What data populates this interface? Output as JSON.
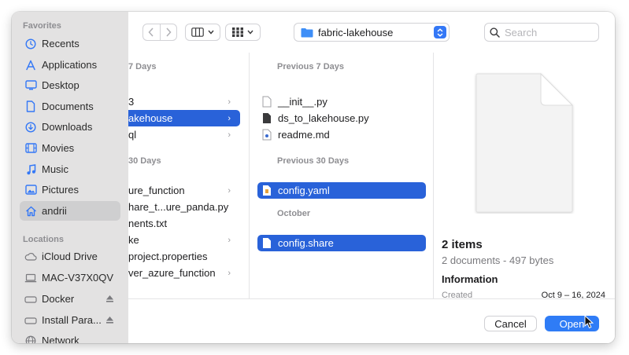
{
  "sidebar": {
    "favorites_heading": "Favorites",
    "favorites": [
      {
        "label": "Recents",
        "icon": "clock-icon"
      },
      {
        "label": "Applications",
        "icon": "applications-icon"
      },
      {
        "label": "Desktop",
        "icon": "desktop-icon"
      },
      {
        "label": "Documents",
        "icon": "document-icon"
      },
      {
        "label": "Downloads",
        "icon": "download-icon"
      },
      {
        "label": "Movies",
        "icon": "film-icon"
      },
      {
        "label": "Music",
        "icon": "music-icon"
      },
      {
        "label": "Pictures",
        "icon": "photo-icon"
      },
      {
        "label": "andrii",
        "icon": "home-icon",
        "selected": true
      }
    ],
    "locations_heading": "Locations",
    "locations": [
      {
        "label": "iCloud Drive",
        "icon": "cloud-icon"
      },
      {
        "label": "MAC-V37X0QV",
        "icon": "laptop-icon"
      },
      {
        "label": "Docker",
        "icon": "drive-icon",
        "eject": true
      },
      {
        "label": "Install Para...",
        "icon": "drive-icon",
        "eject": true
      },
      {
        "label": "Network",
        "icon": "globe-icon"
      }
    ]
  },
  "toolbar": {
    "location": "fabric-lakehouse",
    "search_placeholder": "Search"
  },
  "column1": {
    "headings": [
      "7 Days",
      "30 Days"
    ],
    "items": [
      {
        "label": "3"
      },
      {
        "label": "akehouse",
        "selected": true
      },
      {
        "label": "ql"
      },
      {
        "label": "ure_function"
      },
      {
        "label": "hare_t...ure_panda.py"
      },
      {
        "label": "nents.txt"
      },
      {
        "label": "ke"
      },
      {
        "label": "project.properties"
      },
      {
        "label": "ver_azure_function"
      }
    ]
  },
  "column2": {
    "headings": [
      "Previous 7 Days",
      "Previous 30 Days",
      "October"
    ],
    "items": [
      {
        "label": "__init__.py"
      },
      {
        "label": "ds_to_lakehouse.py"
      },
      {
        "label": "readme.md"
      },
      {
        "label": "config.yaml",
        "selected": true
      },
      {
        "label": "config.share",
        "selected": true
      }
    ]
  },
  "preview": {
    "title": "2 items",
    "subtitle": "2 documents - 497 bytes",
    "info_heading": "Information",
    "created_label": "Created",
    "created_value": "Oct 9 – 16, 2024"
  },
  "buttons": {
    "cancel": "Cancel",
    "open": "Open"
  },
  "colors": {
    "accent": "#2f7cf6",
    "selection": "#2962d9",
    "sidebar_bg": "#e3e2e2"
  }
}
